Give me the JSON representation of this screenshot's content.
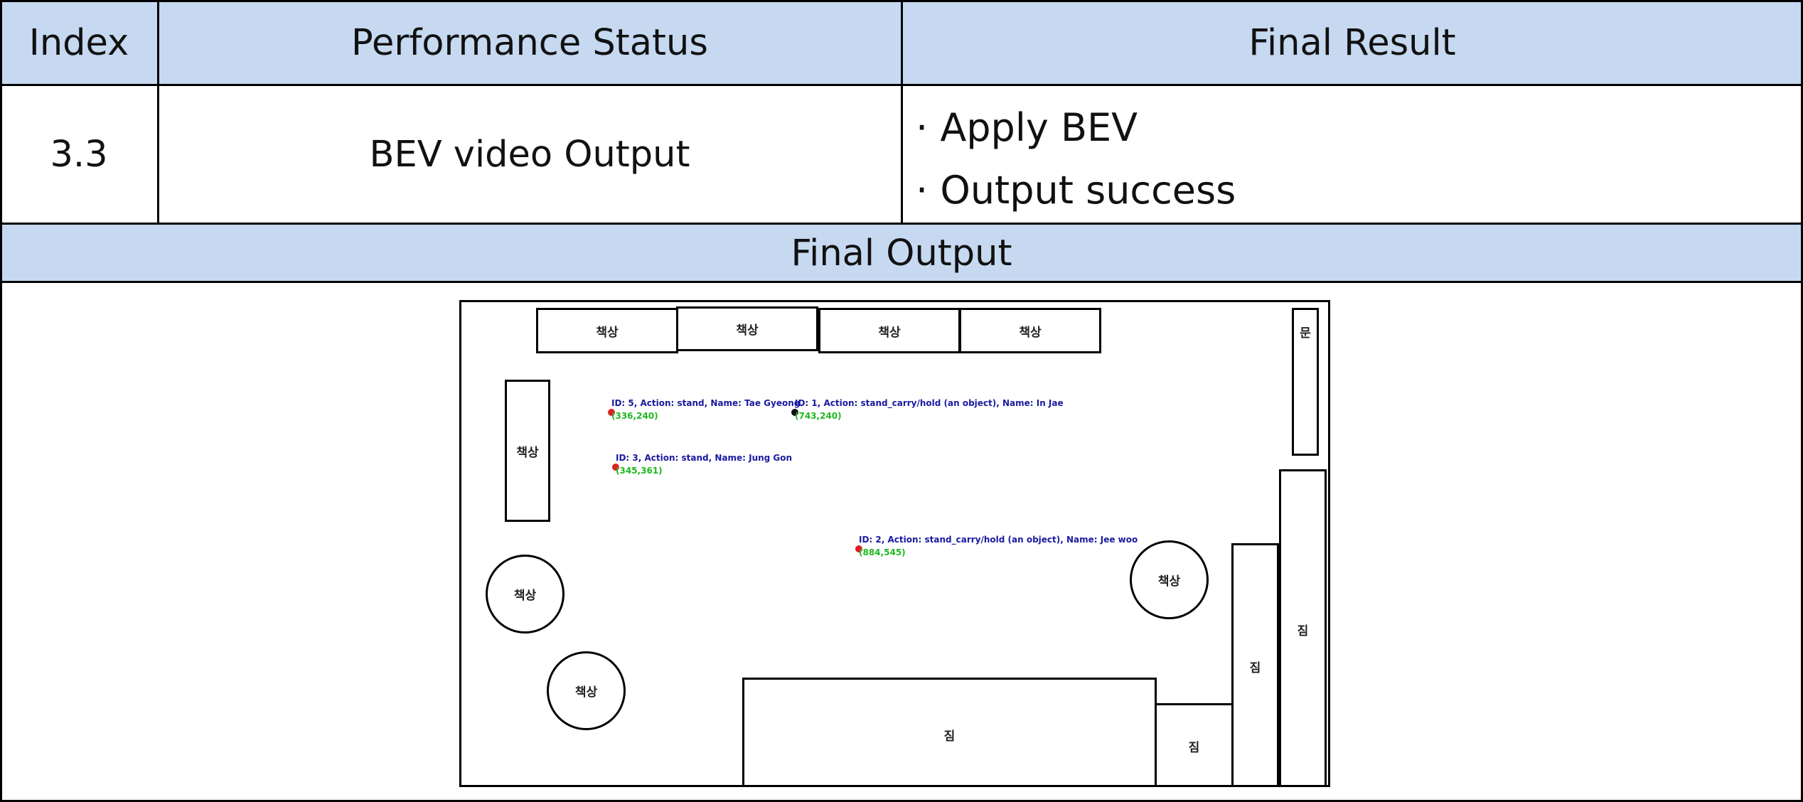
{
  "table": {
    "headers": {
      "index": "Index",
      "status": "Performance Status",
      "result": "Final Result"
    },
    "row": {
      "index": "3.3",
      "status": "BEV video Output",
      "results": [
        "· Apply BEV",
        "· Output success"
      ]
    },
    "section_title": "Final Output"
  },
  "bev_map": {
    "objects": {
      "desk_top_1": "책상",
      "desk_top_2": "책상",
      "desk_top_3": "책상",
      "desk_top_4": "책상",
      "door": "문",
      "desk_left": "책상",
      "round_desk_1": "책상",
      "round_desk_2": "책상",
      "round_desk_3": "책상",
      "luggage_bottom_large": "짐",
      "luggage_bottom_small": "짐",
      "luggage_right_1": "짐",
      "luggage_right_2": "짐"
    },
    "people": [
      {
        "label": "ID: 5, Action: stand, Name: Tae Gyeong",
        "coords": "(336,240)",
        "dot_color": "#e02020"
      },
      {
        "label": "ID: 1, Action: stand_carry/hold (an object), Name: In Jae",
        "coords": "(743,240)",
        "dot_color": "#111111"
      },
      {
        "label": "ID: 3, Action: stand, Name: Jung Gon",
        "coords": "(345,361)",
        "dot_color": "#e02020"
      },
      {
        "label": "ID: 2, Action: stand_carry/hold (an object), Name: Jee woo",
        "coords": "(884,545)",
        "dot_color": "#e02020"
      }
    ]
  },
  "colors": {
    "header_bg": "#c6d9f1",
    "border": "#000000",
    "label_blue": "#1a1aa0",
    "coord_green": "#1fb81f",
    "dot_red": "#e02020"
  }
}
